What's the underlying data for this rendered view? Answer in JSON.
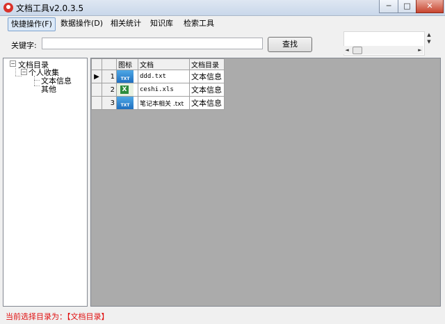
{
  "window": {
    "title": "文档工具v2.0.3.5",
    "min_label": "─",
    "max_label": "□",
    "close_label": "✕"
  },
  "menu": {
    "items": [
      {
        "label": "快捷操作(F)",
        "active": true
      },
      {
        "label": "数据操作(D)"
      },
      {
        "label": "相关统计"
      },
      {
        "label": "知识库"
      },
      {
        "label": "检索工具"
      }
    ]
  },
  "search": {
    "label": "关键字:",
    "value": "",
    "placeholder": "",
    "button": "查找"
  },
  "mini": {
    "spin_up": "▲",
    "spin_down": "▼",
    "left": "◄",
    "right": "►"
  },
  "tree": {
    "root": {
      "label": "文档目录",
      "expander": "−"
    },
    "child": {
      "label": "个人收集",
      "expander": "−"
    },
    "leaves": [
      "文本信息",
      "其他"
    ]
  },
  "grid": {
    "columns": [
      "图标",
      "文档",
      "文档目录"
    ],
    "rows": [
      {
        "num": "1",
        "icon": "txt-file-icon",
        "icon_text": "TXT",
        "doc": "ddd.txt",
        "dir": "文本信息",
        "current": true
      },
      {
        "num": "2",
        "icon": "xls-file-icon",
        "icon_text": "X",
        "doc": "ceshi.xls",
        "dir": "文本信息"
      },
      {
        "num": "3",
        "icon": "txt-file-icon",
        "icon_text": "TXT",
        "doc": "笔记本相关 .txt",
        "dir": "文本信息"
      }
    ],
    "current_marker": "▶"
  },
  "status": {
    "text": "当前选择目录为：【文档目录】"
  },
  "colors": {
    "status_text": "#e01010",
    "grid_background": "#ababab"
  }
}
